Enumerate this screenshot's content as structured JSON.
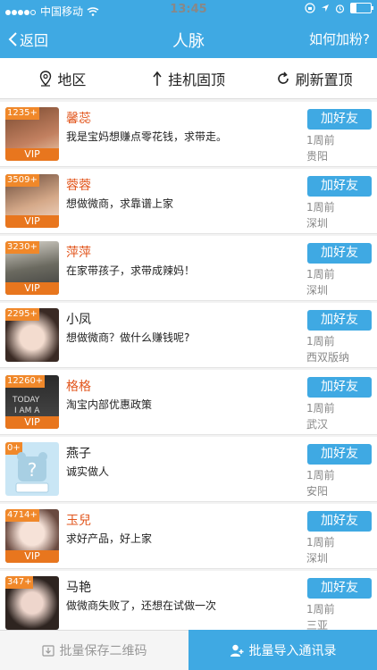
{
  "status": {
    "carrier": "中国移动",
    "time": "13:45"
  },
  "nav": {
    "back": "返回",
    "title": "人脉",
    "howto": "如何加粉?"
  },
  "filters": [
    {
      "icon": "location-pin-icon",
      "label": "地区"
    },
    {
      "icon": "pin-top-icon",
      "label": "挂机固顶"
    },
    {
      "icon": "refresh-icon",
      "label": "刷新置顶"
    }
  ],
  "contacts": [
    {
      "count": "1235+",
      "vip": "VIP",
      "name": "馨蕊",
      "desc": "我是宝妈想赚点零花钱，求带走。",
      "button": "加好友",
      "time": "1周前",
      "location": "贵阳",
      "avatar_color": "#a86a4a"
    },
    {
      "count": "3509+",
      "vip": "VIP",
      "name": "蓉蓉",
      "desc": "想做微商，求靠谱上家",
      "button": "加好友",
      "time": "1周前",
      "location": "深圳",
      "avatar_color": "#c79b7d"
    },
    {
      "count": "3230+",
      "vip": "VIP",
      "name": "萍萍",
      "desc": "在家带孩子，求带成辣妈！",
      "button": "加好友",
      "time": "1周前",
      "location": "深圳",
      "avatar_color": "#8c8a80"
    },
    {
      "count": "2295+",
      "vip": "",
      "name": "小凤",
      "desc": "想做微商？做什么赚钱呢?",
      "button": "加好友",
      "time": "1周前",
      "location": "西双版纳",
      "avatar_color": "#d8c0b0"
    },
    {
      "count": "12260+",
      "vip": "VIP",
      "name": "格格",
      "desc": "淘宝内部优惠政策",
      "button": "加好友",
      "time": "1周前",
      "location": "武汉",
      "avatar_color": "#3a3a3a"
    },
    {
      "count": "0+",
      "vip": "",
      "name": "燕子",
      "desc": "诚实做人",
      "button": "加好友",
      "time": "1周前",
      "location": "安阳",
      "avatar_color": "#bcdff0"
    },
    {
      "count": "4714+",
      "vip": "VIP",
      "name": "玉兒",
      "desc": "求好产品，好上家",
      "button": "加好友",
      "time": "1周前",
      "location": "深圳",
      "avatar_color": "#e6cfc4"
    },
    {
      "count": "347+",
      "vip": "",
      "name": "马艳",
      "desc": "做微商失败了，还想在试做一次",
      "button": "加好友",
      "time": "1周前",
      "location": "三亚",
      "avatar_color": "#5a4a44"
    }
  ],
  "bottom": {
    "save": "批量保存二维码",
    "import": "批量导入通讯录"
  },
  "colors": {
    "primary": "#3fa9e3",
    "vip_name": "#e2561d",
    "badge": "#f0882a"
  }
}
